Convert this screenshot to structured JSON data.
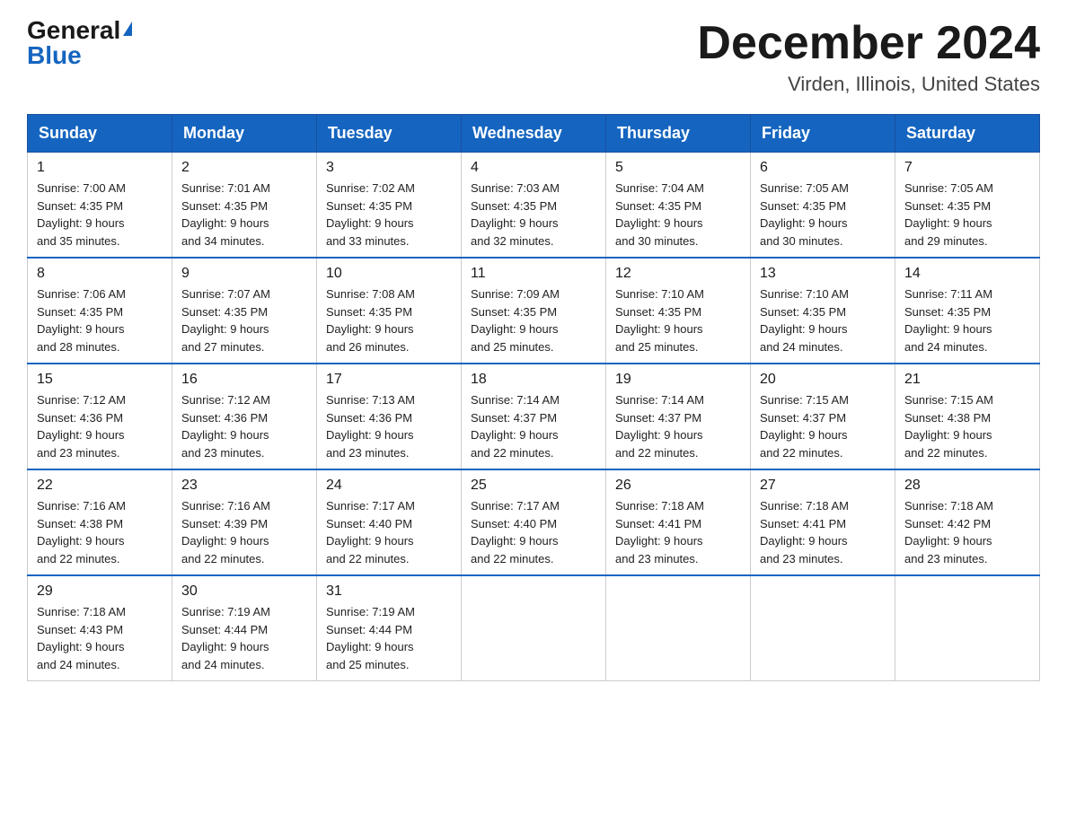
{
  "header": {
    "logo_general": "General",
    "logo_blue": "Blue",
    "month_title": "December 2024",
    "location": "Virden, Illinois, United States"
  },
  "days_of_week": [
    "Sunday",
    "Monday",
    "Tuesday",
    "Wednesday",
    "Thursday",
    "Friday",
    "Saturday"
  ],
  "weeks": [
    [
      {
        "day": "1",
        "sunrise": "7:00 AM",
        "sunset": "4:35 PM",
        "daylight": "9 hours and 35 minutes."
      },
      {
        "day": "2",
        "sunrise": "7:01 AM",
        "sunset": "4:35 PM",
        "daylight": "9 hours and 34 minutes."
      },
      {
        "day": "3",
        "sunrise": "7:02 AM",
        "sunset": "4:35 PM",
        "daylight": "9 hours and 33 minutes."
      },
      {
        "day": "4",
        "sunrise": "7:03 AM",
        "sunset": "4:35 PM",
        "daylight": "9 hours and 32 minutes."
      },
      {
        "day": "5",
        "sunrise": "7:04 AM",
        "sunset": "4:35 PM",
        "daylight": "9 hours and 30 minutes."
      },
      {
        "day": "6",
        "sunrise": "7:05 AM",
        "sunset": "4:35 PM",
        "daylight": "9 hours and 30 minutes."
      },
      {
        "day": "7",
        "sunrise": "7:05 AM",
        "sunset": "4:35 PM",
        "daylight": "9 hours and 29 minutes."
      }
    ],
    [
      {
        "day": "8",
        "sunrise": "7:06 AM",
        "sunset": "4:35 PM",
        "daylight": "9 hours and 28 minutes."
      },
      {
        "day": "9",
        "sunrise": "7:07 AM",
        "sunset": "4:35 PM",
        "daylight": "9 hours and 27 minutes."
      },
      {
        "day": "10",
        "sunrise": "7:08 AM",
        "sunset": "4:35 PM",
        "daylight": "9 hours and 26 minutes."
      },
      {
        "day": "11",
        "sunrise": "7:09 AM",
        "sunset": "4:35 PM",
        "daylight": "9 hours and 25 minutes."
      },
      {
        "day": "12",
        "sunrise": "7:10 AM",
        "sunset": "4:35 PM",
        "daylight": "9 hours and 25 minutes."
      },
      {
        "day": "13",
        "sunrise": "7:10 AM",
        "sunset": "4:35 PM",
        "daylight": "9 hours and 24 minutes."
      },
      {
        "day": "14",
        "sunrise": "7:11 AM",
        "sunset": "4:35 PM",
        "daylight": "9 hours and 24 minutes."
      }
    ],
    [
      {
        "day": "15",
        "sunrise": "7:12 AM",
        "sunset": "4:36 PM",
        "daylight": "9 hours and 23 minutes."
      },
      {
        "day": "16",
        "sunrise": "7:12 AM",
        "sunset": "4:36 PM",
        "daylight": "9 hours and 23 minutes."
      },
      {
        "day": "17",
        "sunrise": "7:13 AM",
        "sunset": "4:36 PM",
        "daylight": "9 hours and 23 minutes."
      },
      {
        "day": "18",
        "sunrise": "7:14 AM",
        "sunset": "4:37 PM",
        "daylight": "9 hours and 22 minutes."
      },
      {
        "day": "19",
        "sunrise": "7:14 AM",
        "sunset": "4:37 PM",
        "daylight": "9 hours and 22 minutes."
      },
      {
        "day": "20",
        "sunrise": "7:15 AM",
        "sunset": "4:37 PM",
        "daylight": "9 hours and 22 minutes."
      },
      {
        "day": "21",
        "sunrise": "7:15 AM",
        "sunset": "4:38 PM",
        "daylight": "9 hours and 22 minutes."
      }
    ],
    [
      {
        "day": "22",
        "sunrise": "7:16 AM",
        "sunset": "4:38 PM",
        "daylight": "9 hours and 22 minutes."
      },
      {
        "day": "23",
        "sunrise": "7:16 AM",
        "sunset": "4:39 PM",
        "daylight": "9 hours and 22 minutes."
      },
      {
        "day": "24",
        "sunrise": "7:17 AM",
        "sunset": "4:40 PM",
        "daylight": "9 hours and 22 minutes."
      },
      {
        "day": "25",
        "sunrise": "7:17 AM",
        "sunset": "4:40 PM",
        "daylight": "9 hours and 22 minutes."
      },
      {
        "day": "26",
        "sunrise": "7:18 AM",
        "sunset": "4:41 PM",
        "daylight": "9 hours and 23 minutes."
      },
      {
        "day": "27",
        "sunrise": "7:18 AM",
        "sunset": "4:41 PM",
        "daylight": "9 hours and 23 minutes."
      },
      {
        "day": "28",
        "sunrise": "7:18 AM",
        "sunset": "4:42 PM",
        "daylight": "9 hours and 23 minutes."
      }
    ],
    [
      {
        "day": "29",
        "sunrise": "7:18 AM",
        "sunset": "4:43 PM",
        "daylight": "9 hours and 24 minutes."
      },
      {
        "day": "30",
        "sunrise": "7:19 AM",
        "sunset": "4:44 PM",
        "daylight": "9 hours and 24 minutes."
      },
      {
        "day": "31",
        "sunrise": "7:19 AM",
        "sunset": "4:44 PM",
        "daylight": "9 hours and 25 minutes."
      },
      null,
      null,
      null,
      null
    ]
  ],
  "labels": {
    "sunrise_prefix": "Sunrise: ",
    "sunset_prefix": "Sunset: ",
    "daylight_prefix": "Daylight: "
  }
}
